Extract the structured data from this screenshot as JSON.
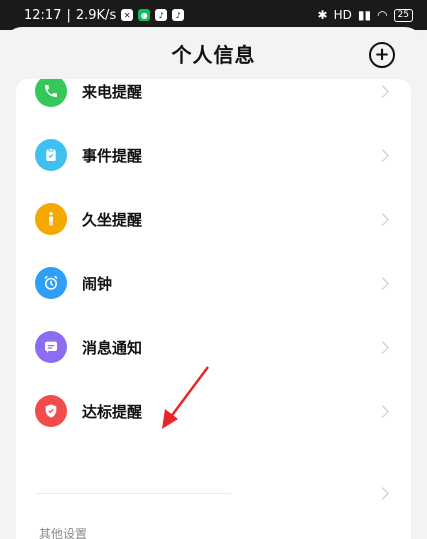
{
  "status_bar": {
    "time": "12:17",
    "speed": "2.9K/s",
    "battery": "25",
    "network": "HD"
  },
  "header": {
    "title": "个人信息"
  },
  "reminders": [
    {
      "label": "来电提醒",
      "icon": "phone-icon",
      "color": "#34c759"
    },
    {
      "label": "事件提醒",
      "icon": "clipboard-icon",
      "color": "#3fc1f0"
    },
    {
      "label": "久坐提醒",
      "icon": "person-standing-icon",
      "color": "#f5a800"
    },
    {
      "label": "闹钟",
      "icon": "alarm-clock-icon",
      "color": "#2f9ef5"
    },
    {
      "label": "消息通知",
      "icon": "message-icon",
      "color": "#8c6cf0"
    },
    {
      "label": "达标提醒",
      "icon": "shield-check-icon",
      "color": "#f24b4b"
    }
  ],
  "other_settings": {
    "section_label": "其他设置"
  }
}
